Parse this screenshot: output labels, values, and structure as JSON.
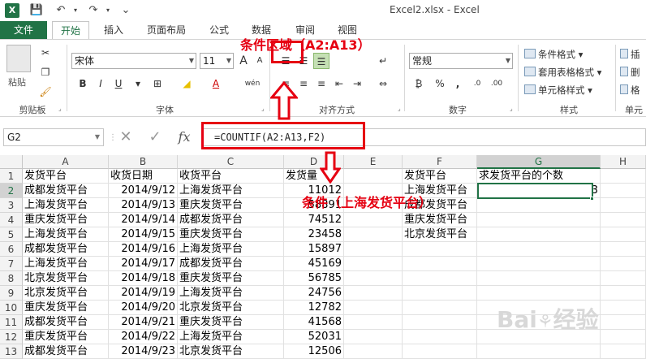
{
  "window": {
    "title": "Excel2.xlsx - Excel",
    "app_icon": "X"
  },
  "quick_access": {
    "save": "💾",
    "undo": "↶",
    "redo": "↷",
    "more": "⌄"
  },
  "tabs": [
    {
      "label": "文件"
    },
    {
      "label": "开始"
    },
    {
      "label": "插入"
    },
    {
      "label": "页面布局"
    },
    {
      "label": "公式"
    },
    {
      "label": "数据"
    },
    {
      "label": "审阅"
    },
    {
      "label": "视图"
    }
  ],
  "ribbon": {
    "clipboard": {
      "paste": "粘贴",
      "group": "剪贴板"
    },
    "font": {
      "family": "宋体",
      "size": "11",
      "bold": "B",
      "italic": "I",
      "underline": "U",
      "grow": "A",
      "shrink": "A",
      "wen": "wén",
      "font_color": "A",
      "group": "字体"
    },
    "align": {
      "group": "对齐方式"
    },
    "number": {
      "format": "常规",
      "percent": "%",
      "comma": ",",
      "group": "数字"
    },
    "styles": {
      "cond": "条件格式",
      "table": "套用表格格式",
      "cell": "单元格样式",
      "group": "样式"
    },
    "cells": {
      "insert": "插",
      "delete": "删",
      "format": "格",
      "group": "单元"
    }
  },
  "formula_bar": {
    "name_box": "G2",
    "cancel": "✕",
    "enter": "✓",
    "fx": "fx",
    "formula": "=COUNTIF(A2:A13,F2)"
  },
  "sheet": {
    "columns": [
      "A",
      "B",
      "C",
      "D",
      "E",
      "F",
      "G",
      "H"
    ],
    "rows": [
      {
        "n": "1",
        "a": "发货平台",
        "b": "收货日期",
        "c": "收货平台",
        "d": "发货量",
        "f": "发货平台",
        "g": "求发货平台的个数"
      },
      {
        "n": "2",
        "a": "成都发货平台",
        "b": "2014/9/12",
        "c": "上海发货平台",
        "d": "11012",
        "f": "上海发货平台",
        "g": "3"
      },
      {
        "n": "3",
        "a": "上海发货平台",
        "b": "2014/9/13",
        "c": "重庆发货平台",
        "d": "58891",
        "f": "成都发货平台",
        "g": ""
      },
      {
        "n": "4",
        "a": "重庆发货平台",
        "b": "2014/9/14",
        "c": "成都发货平台",
        "d": "74512",
        "f": "重庆发货平台",
        "g": ""
      },
      {
        "n": "5",
        "a": "上海发货平台",
        "b": "2014/9/15",
        "c": "重庆发货平台",
        "d": "23458",
        "f": "北京发货平台",
        "g": ""
      },
      {
        "n": "6",
        "a": "成都发货平台",
        "b": "2014/9/16",
        "c": "上海发货平台",
        "d": "15897",
        "f": "",
        "g": ""
      },
      {
        "n": "7",
        "a": "上海发货平台",
        "b": "2014/9/17",
        "c": "成都发货平台",
        "d": "45169",
        "f": "",
        "g": ""
      },
      {
        "n": "8",
        "a": "北京发货平台",
        "b": "2014/9/18",
        "c": "重庆发货平台",
        "d": "56785",
        "f": "",
        "g": ""
      },
      {
        "n": "9",
        "a": "北京发货平台",
        "b": "2014/9/19",
        "c": "上海发货平台",
        "d": "24756",
        "f": "",
        "g": ""
      },
      {
        "n": "10",
        "a": "重庆发货平台",
        "b": "2014/9/20",
        "c": "北京发货平台",
        "d": "12782",
        "f": "",
        "g": ""
      },
      {
        "n": "11",
        "a": "成都发货平台",
        "b": "2014/9/21",
        "c": "重庆发货平台",
        "d": "41568",
        "f": "",
        "g": ""
      },
      {
        "n": "12",
        "a": "重庆发货平台",
        "b": "2014/9/22",
        "c": "上海发货平台",
        "d": "52031",
        "f": "",
        "g": ""
      },
      {
        "n": "13",
        "a": "成都发货平台",
        "b": "2014/9/23",
        "c": "北京发货平台",
        "d": "12506",
        "f": "",
        "g": ""
      }
    ]
  },
  "annotations": {
    "range_label": "条件区域（A2:A13）",
    "criteria_label": "条件（上海发货平台）",
    "color": "#e60012"
  },
  "colors": {
    "excel_green": "#217346"
  }
}
